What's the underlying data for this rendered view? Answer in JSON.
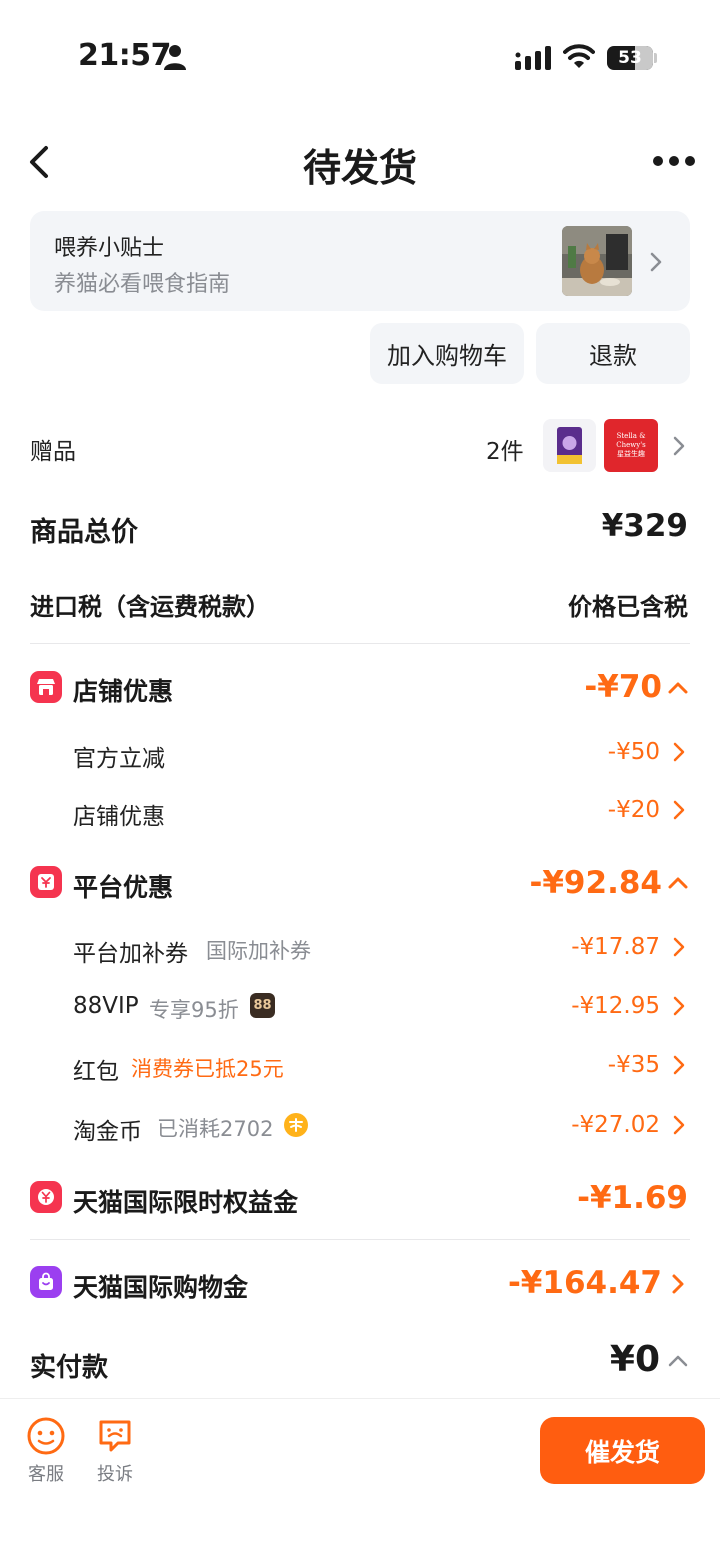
{
  "status_bar": {
    "time": "21:57",
    "battery": "53"
  },
  "header": {
    "title": "待发货"
  },
  "tip": {
    "title": "喂养小贴士",
    "subtitle": "养猫必看喂食指南"
  },
  "actions": {
    "add_to_cart": "加入购物车",
    "refund": "退款"
  },
  "gift": {
    "label": "赠品",
    "count": "2件",
    "brand_line1": "Stella & Chewy's",
    "brand_line2": "星益生趣"
  },
  "summary": {
    "total_label": "商品总价",
    "total_value": "¥329",
    "tax_label": "进口税（含运费税款）",
    "tax_value": "价格已含税"
  },
  "store_discount": {
    "label": "店铺优惠",
    "value": "-¥70",
    "items": [
      {
        "label": "官方立减",
        "value": "-¥50"
      },
      {
        "label": "店铺优惠",
        "value": "-¥20"
      }
    ]
  },
  "platform_discount": {
    "label": "平台优惠",
    "value": "-¥92.84",
    "items": [
      {
        "label": "平台加补券",
        "note": "国际加补券",
        "value": "-¥17.87"
      },
      {
        "label": "88VIP",
        "note": "专享95折",
        "badge": "88",
        "value": "-¥12.95"
      },
      {
        "label": "红包",
        "note": "消费券已抵25元",
        "value": "-¥35"
      },
      {
        "label": "淘金币",
        "note": "已消耗2702",
        "value": "-¥27.02"
      }
    ]
  },
  "benefit": {
    "label": "天猫国际限时权益金",
    "value": "-¥1.69"
  },
  "shopping_gold": {
    "label": "天猫国际购物金",
    "value": "-¥164.47"
  },
  "payment": {
    "label": "实付款",
    "value": "¥0"
  },
  "bottom": {
    "service": "客服",
    "complaint": "投诉",
    "cta": "催发货"
  },
  "colors": {
    "accent": "#ff6a13",
    "cta": "#ff5d10",
    "store_icon": "#f5344f",
    "platform_icon": "#f5344f",
    "benefit_icon": "#f5344f",
    "gold_icon": "#9b3ff0",
    "coin": "#ffb21a"
  }
}
